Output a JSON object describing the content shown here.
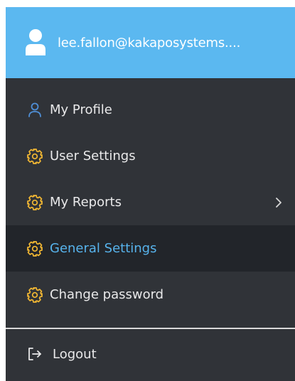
{
  "header": {
    "email": "lee.fallon@kakaposystems...."
  },
  "menu": {
    "items": [
      {
        "label": "My Profile",
        "icon": "user-icon"
      },
      {
        "label": "User Settings",
        "icon": "gear-icon"
      },
      {
        "label": "My Reports",
        "icon": "gear-icon",
        "has_submenu": true
      },
      {
        "label": "General Settings",
        "icon": "gear-icon",
        "active": true
      },
      {
        "label": "Change password",
        "icon": "gear-icon"
      }
    ],
    "logout_label": "Logout"
  },
  "colors": {
    "header_bg": "#5bb8f0",
    "menu_bg": "#303338",
    "active_bg": "#22252a",
    "active_text": "#57b3ec",
    "gear_icon": "#f3b833",
    "profile_icon": "#4f8fd6"
  }
}
